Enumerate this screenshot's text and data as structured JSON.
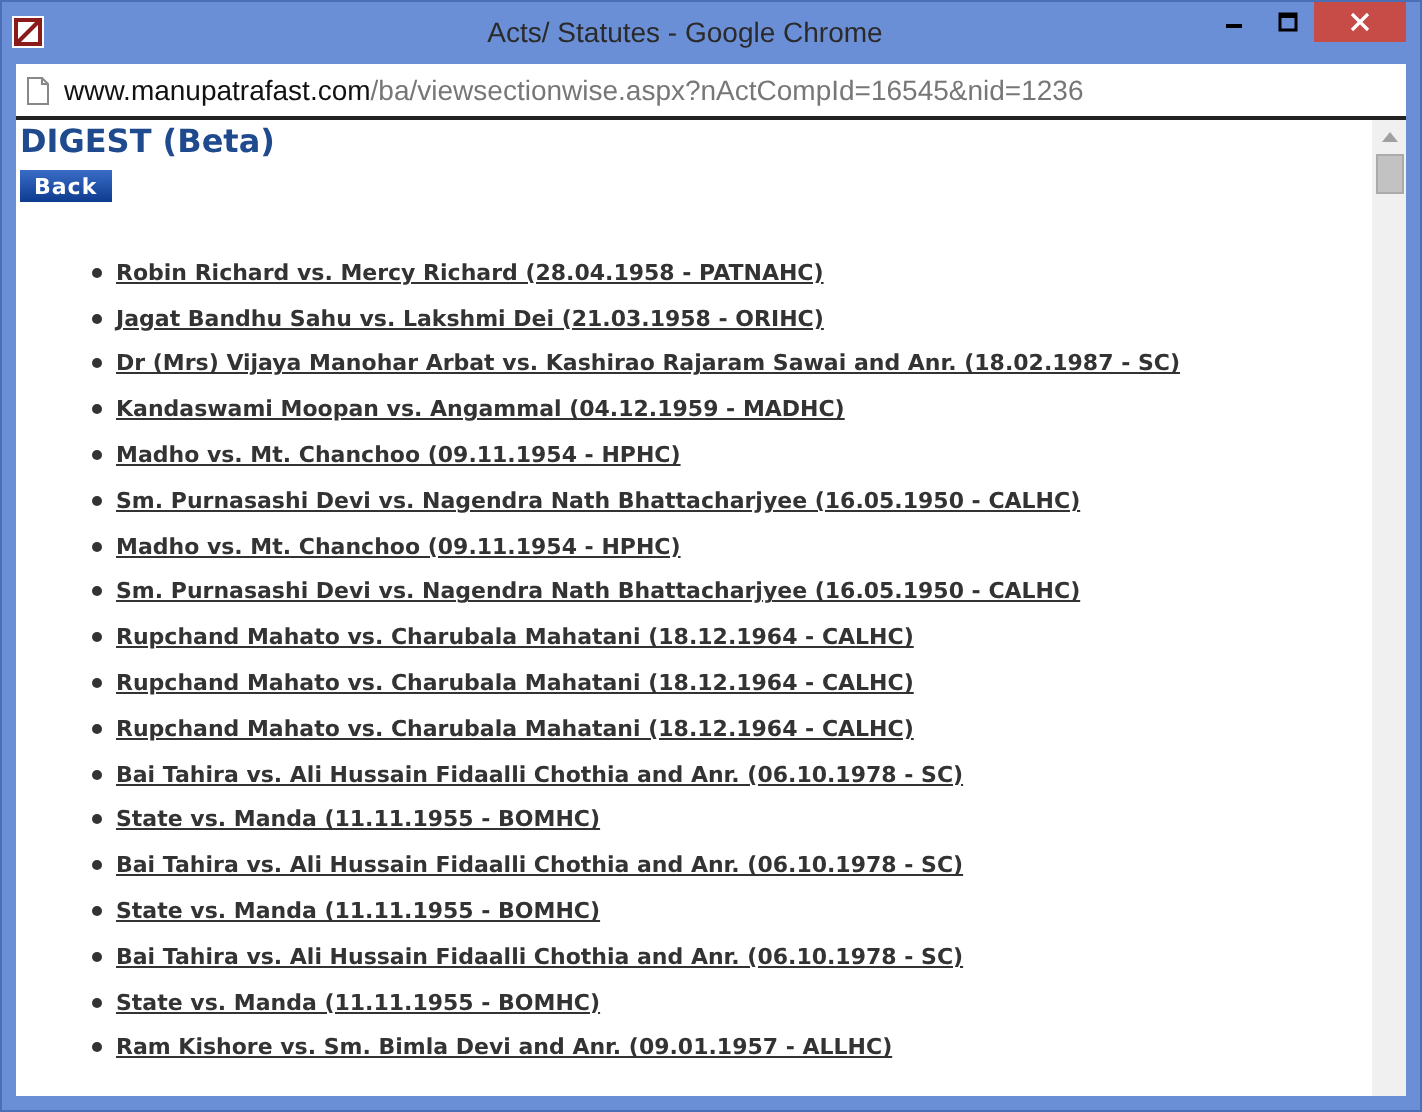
{
  "window": {
    "title": "Acts/ Statutes - Google Chrome"
  },
  "address_bar": {
    "domain": "www.manupatrafast.com",
    "path": "/ba/viewsectionwise.aspx?nActCompId=16545&nid=1236"
  },
  "page": {
    "heading": "DIGEST (Beta)",
    "back_button": "Back",
    "links": [
      "Robin Richard vs. Mercy Richard (28.04.1958 - PATNAHC)",
      "Jagat Bandhu Sahu vs. Lakshmi Dei (21.03.1958 - ORIHC)",
      "Dr (Mrs) Vijaya Manohar Arbat vs. Kashirao Rajaram Sawai and Anr. (18.02.1987 - SC)",
      "Kandaswami Moopan vs. Angammal (04.12.1959 - MADHC)",
      "Madho vs. Mt. Chanchoo (09.11.1954 - HPHC)",
      "Sm. Purnasashi Devi vs. Nagendra Nath Bhattacharjyee (16.05.1950 - CALHC)",
      "Madho vs. Mt. Chanchoo (09.11.1954 - HPHC)",
      "Sm. Purnasashi Devi vs. Nagendra Nath Bhattacharjyee (16.05.1950 - CALHC)",
      "Rupchand Mahato vs. Charubala Mahatani (18.12.1964 - CALHC)",
      "Rupchand Mahato vs. Charubala Mahatani (18.12.1964 - CALHC)",
      "Rupchand Mahato vs. Charubala Mahatani (18.12.1964 - CALHC)",
      "Bai Tahira vs. Ali Hussain Fidaalli Chothia and Anr. (06.10.1978 - SC)",
      "State vs. Manda (11.11.1955 - BOMHC)",
      "Bai Tahira vs. Ali Hussain Fidaalli Chothia and Anr. (06.10.1978 - SC)",
      "State vs. Manda (11.11.1955 - BOMHC)",
      "Bai Tahira vs. Ali Hussain Fidaalli Chothia and Anr. (06.10.1978 - SC)",
      "State vs. Manda (11.11.1955 - BOMHC)",
      "Ram Kishore vs. Sm. Bimla Devi and Anr. (09.01.1957 - ALLHC)"
    ]
  }
}
